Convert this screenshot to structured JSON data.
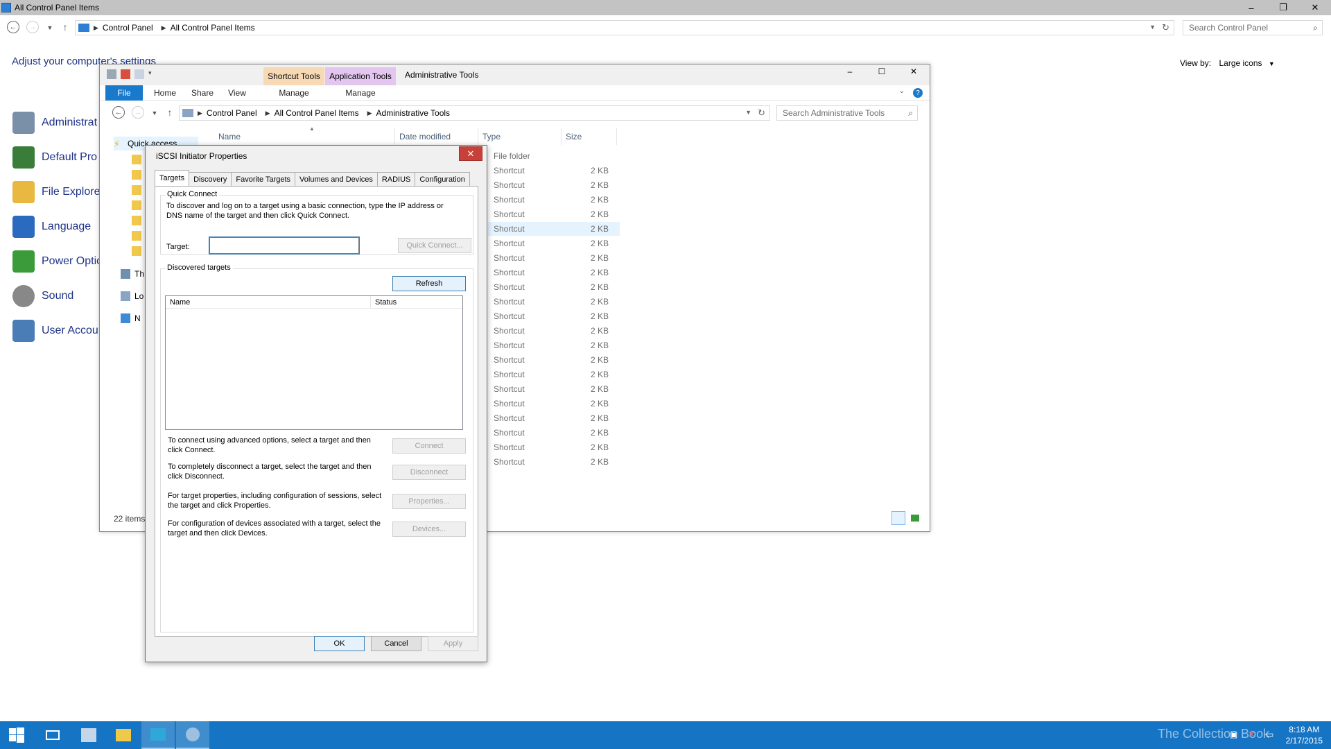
{
  "control_panel": {
    "window_title": "All Control Panel Items",
    "window_controls": [
      "–",
      "❐",
      "✕"
    ],
    "breadcrumb": [
      "Control Panel",
      "All Control Panel Items"
    ],
    "search_placeholder": "Search Control Panel",
    "heading": "Adjust your computer's settings",
    "view_by_label": "View by:",
    "view_by_value": "Large icons",
    "items": [
      {
        "label": "Administrat",
        "icon": "admin-tools-icon",
        "color": "#7a8fa8"
      },
      {
        "label": "Default Pro",
        "icon": "default-programs-icon",
        "color": "#3a7d3a"
      },
      {
        "label": "File Explore",
        "icon": "folder-icon",
        "color": "#e8b840"
      },
      {
        "label": "Language",
        "icon": "language-icon",
        "color": "#2a6bbf"
      },
      {
        "label": "Power Optio",
        "icon": "power-icon",
        "color": "#3b9b3b"
      },
      {
        "label": "Sound",
        "icon": "speaker-icon",
        "color": "#888888"
      },
      {
        "label": "User Accou",
        "icon": "users-icon",
        "color": "#4a7db5"
      }
    ]
  },
  "explorer": {
    "title": "Administrative Tools",
    "context_tabs": [
      {
        "label": "Shortcut Tools",
        "color": "#f7d9b5"
      },
      {
        "label": "Application Tools",
        "color": "#e3c6f0"
      }
    ],
    "window_controls": [
      "–",
      "☐",
      "✕"
    ],
    "ribbon_tabs": [
      "File",
      "Home",
      "Share",
      "View",
      "Manage",
      "Manage"
    ],
    "help": "?",
    "breadcrumb": [
      "Control Panel",
      "All Control Panel Items",
      "Administrative Tools"
    ],
    "search_placeholder": "Search Administrative Tools",
    "columns": [
      "Name",
      "Date modified",
      "Type",
      "Size"
    ],
    "nav": [
      {
        "label": "Quick access",
        "icon": "star-icon"
      },
      {
        "label": "Th",
        "icon": "pc-icon"
      },
      {
        "label": "Lo",
        "icon": "libraries-icon"
      },
      {
        "label": "N",
        "icon": "network-icon"
      }
    ],
    "rows": [
      {
        "type": "File folder",
        "size": ""
      },
      {
        "type": "Shortcut",
        "size": "2 KB"
      },
      {
        "type": "Shortcut",
        "size": "2 KB"
      },
      {
        "type": "Shortcut",
        "size": "2 KB"
      },
      {
        "type": "Shortcut",
        "size": "2 KB"
      },
      {
        "type": "Shortcut",
        "size": "2 KB"
      },
      {
        "type": "Shortcut",
        "size": "2 KB"
      },
      {
        "type": "Shortcut",
        "size": "2 KB"
      },
      {
        "type": "Shortcut",
        "size": "2 KB"
      },
      {
        "type": "Shortcut",
        "size": "2 KB"
      },
      {
        "type": "Shortcut",
        "size": "2 KB"
      },
      {
        "type": "Shortcut",
        "size": "2 KB"
      },
      {
        "type": "Shortcut",
        "size": "2 KB"
      },
      {
        "type": "Shortcut",
        "size": "2 KB"
      },
      {
        "type": "Shortcut",
        "size": "2 KB"
      },
      {
        "type": "Shortcut",
        "size": "2 KB"
      },
      {
        "type": "Shortcut",
        "size": "2 KB"
      },
      {
        "type": "Shortcut",
        "size": "2 KB"
      },
      {
        "type": "Shortcut",
        "size": "2 KB"
      },
      {
        "type": "Shortcut",
        "size": "2 KB"
      },
      {
        "type": "Shortcut",
        "size": "2 KB"
      },
      {
        "type": "Shortcut",
        "size": "2 KB"
      }
    ],
    "status": "22 items"
  },
  "dialog": {
    "title": "iSCSI Initiator Properties",
    "close": "✕",
    "tabs": [
      "Targets",
      "Discovery",
      "Favorite Targets",
      "Volumes and Devices",
      "RADIUS",
      "Configuration"
    ],
    "quick_connect": {
      "label": "Quick Connect",
      "description": "To discover and log on to a target using a basic connection, type the IP address or DNS name of the target and then click Quick Connect.",
      "target_label": "Target:",
      "target_value": "",
      "button": "Quick Connect..."
    },
    "discovered": {
      "label": "Discovered targets",
      "refresh": "Refresh",
      "columns": [
        "Name",
        "Status"
      ]
    },
    "actions": [
      {
        "text": "To connect using advanced options, select a target and then click Connect.",
        "button": "Connect"
      },
      {
        "text": "To completely disconnect a target, select the target and then click Disconnect.",
        "button": "Disconnect"
      },
      {
        "text": "For target properties, including configuration of sessions, select the target and click Properties.",
        "button": "Properties..."
      },
      {
        "text": "For configuration of devices associated with a target, select the target and then click Devices.",
        "button": "Devices..."
      }
    ],
    "ok": "OK",
    "cancel": "Cancel",
    "apply": "Apply"
  },
  "taskbar": {
    "time": "8:18 AM",
    "date": "2/17/2015",
    "watermark": "The Collection Book",
    "accent": "#1674c4"
  }
}
